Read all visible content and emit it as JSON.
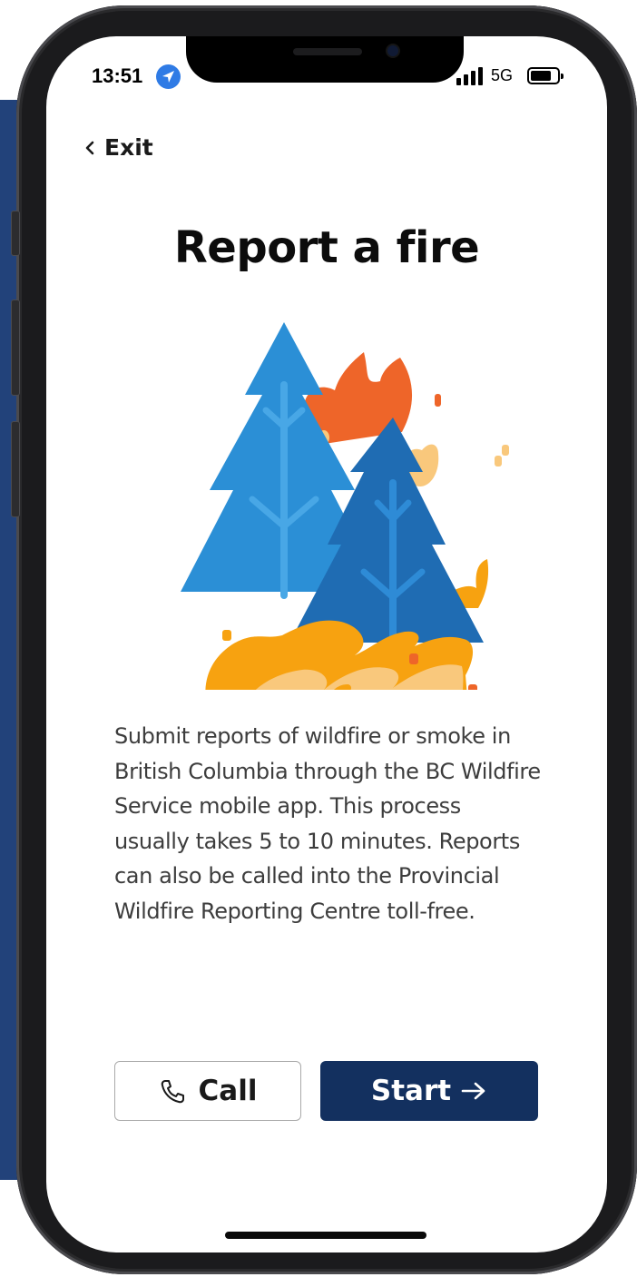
{
  "status_bar": {
    "time": "13:51",
    "network": "5G",
    "icons": [
      "location-arrow-icon",
      "signal-bars-icon",
      "battery-icon"
    ]
  },
  "nav": {
    "exit_label": "Exit",
    "exit_icon": "chevron-left-icon"
  },
  "page": {
    "title": "Report a fire",
    "illustration": "wildfire-trees-illustration",
    "description": "Submit reports of wildfire or smoke in British Columbia through the BC Wildfire Service mobile app. This process usually takes 5 to 10 minutes. Reports can also be called into the Provincial Wildfire Reporting Centre toll-free."
  },
  "actions": {
    "call_label": "Call",
    "call_icon": "phone-icon",
    "start_label": "Start",
    "start_icon": "arrow-right-icon"
  },
  "colors": {
    "primary_button": "#13305f",
    "tree_light": "#2b8fd6",
    "tree_dark": "#1f6cb3",
    "flame_orange": "#f7a210",
    "flame_light": "#f9c87c",
    "flame_red": "#ee6529"
  }
}
